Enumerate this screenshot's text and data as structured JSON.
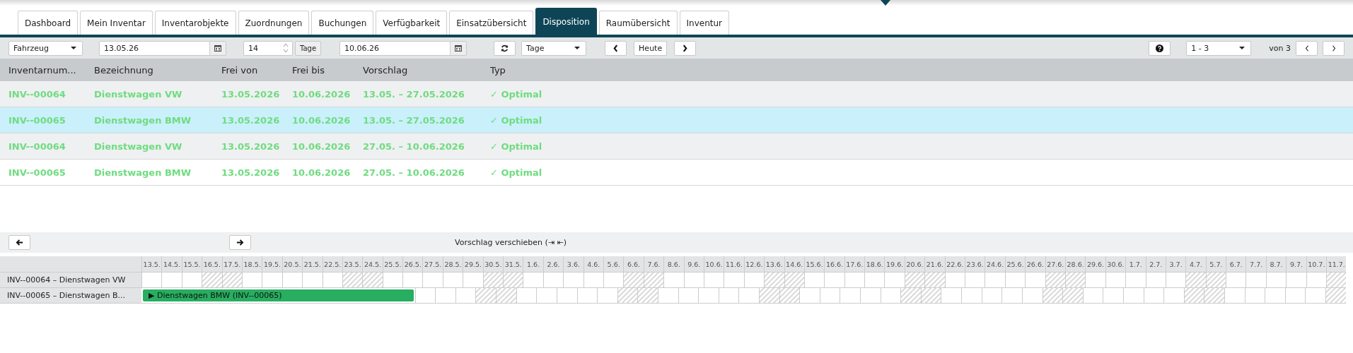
{
  "tabs": [
    {
      "label": "Dashboard",
      "selected": false
    },
    {
      "label": "Mein Inventar",
      "selected": false
    },
    {
      "label": "Inventarobjekte",
      "selected": false
    },
    {
      "label": "Zuordnungen",
      "selected": false
    },
    {
      "label": "Buchungen",
      "selected": false
    },
    {
      "label": "Verfügbarkeit",
      "selected": false
    },
    {
      "label": "Einsatzübersicht",
      "selected": false
    },
    {
      "label": "Disposition",
      "selected": true
    },
    {
      "label": "Raumübersicht",
      "selected": false
    },
    {
      "label": "Inventur",
      "selected": false
    }
  ],
  "toolbar": {
    "category": "Fahrzeug",
    "start_date": "13.05.26",
    "duration": "14",
    "duration_unit": "Tage",
    "end_date": "10.06.26",
    "scale": "Tage",
    "today": "Heute",
    "page_range": "1 - 3",
    "page_total": "von 3"
  },
  "table": {
    "columns": [
      "Inventarnum...",
      "Bezeichnung",
      "Frei von",
      "Frei bis",
      "Vorschlag",
      "Typ"
    ],
    "rows": [
      {
        "selected": false,
        "cells": [
          "INV--00064",
          "Dienstwagen VW",
          "13.05.2026",
          "10.06.2026",
          "13.05. – 27.05.2026",
          "✓ Optimal"
        ]
      },
      {
        "selected": true,
        "cells": [
          "INV--00065",
          "Dienstwagen BMW",
          "13.05.2026",
          "10.06.2026",
          "13.05. – 27.05.2026",
          "✓ Optimal"
        ]
      },
      {
        "selected": false,
        "cells": [
          "INV--00064",
          "Dienstwagen VW",
          "13.05.2026",
          "10.06.2026",
          "27.05. – 10.06.2026",
          "✓ Optimal"
        ]
      },
      {
        "selected": false,
        "cells": [
          "INV--00065",
          "Dienstwagen BMW",
          "13.05.2026",
          "10.06.2026",
          "27.05. – 10.06.2026",
          "✓ Optimal"
        ]
      }
    ]
  },
  "timeline": {
    "shift_label": "Vorschlag verschieben (⇥ ⇤)",
    "days": [
      {
        "label": "13.5.",
        "weekend": false
      },
      {
        "label": "14.5.",
        "weekend": false
      },
      {
        "label": "15.5.",
        "weekend": false
      },
      {
        "label": "16.5.",
        "weekend": true
      },
      {
        "label": "17.5.",
        "weekend": true
      },
      {
        "label": "18.5.",
        "weekend": false
      },
      {
        "label": "19.5.",
        "weekend": false
      },
      {
        "label": "20.5.",
        "weekend": false
      },
      {
        "label": "21.5.",
        "weekend": false
      },
      {
        "label": "22.5.",
        "weekend": false
      },
      {
        "label": "23.5.",
        "weekend": true
      },
      {
        "label": "24.5.",
        "weekend": true
      },
      {
        "label": "25.5.",
        "weekend": false
      },
      {
        "label": "26.5.",
        "weekend": false
      },
      {
        "label": "27.5.",
        "weekend": false
      },
      {
        "label": "28.5.",
        "weekend": false
      },
      {
        "label": "29.5.",
        "weekend": false
      },
      {
        "label": "30.5.",
        "weekend": true
      },
      {
        "label": "31.5.",
        "weekend": true
      },
      {
        "label": "1.6.",
        "weekend": false
      },
      {
        "label": "2.6.",
        "weekend": false
      },
      {
        "label": "3.6.",
        "weekend": false
      },
      {
        "label": "4.6.",
        "weekend": false
      },
      {
        "label": "5.6.",
        "weekend": false
      },
      {
        "label": "6.6.",
        "weekend": true
      },
      {
        "label": "7.6.",
        "weekend": true
      },
      {
        "label": "8.6.",
        "weekend": false
      },
      {
        "label": "9.6.",
        "weekend": false
      },
      {
        "label": "10.6.",
        "weekend": false
      },
      {
        "label": "11.6.",
        "weekend": false
      },
      {
        "label": "12.6.",
        "weekend": false
      },
      {
        "label": "13.6.",
        "weekend": true
      },
      {
        "label": "14.6.",
        "weekend": true
      },
      {
        "label": "15.6.",
        "weekend": false
      },
      {
        "label": "16.6.",
        "weekend": false
      },
      {
        "label": "17.6.",
        "weekend": false
      },
      {
        "label": "18.6.",
        "weekend": false
      },
      {
        "label": "19.6.",
        "weekend": false
      },
      {
        "label": "20.6.",
        "weekend": true
      },
      {
        "label": "21.6.",
        "weekend": true
      },
      {
        "label": "22.6.",
        "weekend": false
      },
      {
        "label": "23.6.",
        "weekend": false
      },
      {
        "label": "24.6.",
        "weekend": false
      },
      {
        "label": "25.6.",
        "weekend": false
      },
      {
        "label": "26.6.",
        "weekend": false
      },
      {
        "label": "27.6.",
        "weekend": true
      },
      {
        "label": "28.6.",
        "weekend": true
      },
      {
        "label": "29.6.",
        "weekend": false
      },
      {
        "label": "30.6.",
        "weekend": false
      },
      {
        "label": "1.7.",
        "weekend": false
      },
      {
        "label": "2.7.",
        "weekend": false
      },
      {
        "label": "3.7.",
        "weekend": false
      },
      {
        "label": "4.7.",
        "weekend": true
      },
      {
        "label": "5.7.",
        "weekend": true
      },
      {
        "label": "6.7.",
        "weekend": false
      },
      {
        "label": "7.7.",
        "weekend": false
      },
      {
        "label": "8.7.",
        "weekend": false
      },
      {
        "label": "9.7.",
        "weekend": false
      },
      {
        "label": "10.7.",
        "weekend": false
      },
      {
        "label": "11.7.",
        "weekend": true
      }
    ],
    "rows": [
      {
        "label": "INV--00064 – Dienstwagen VW"
      },
      {
        "label": "INV--00065 – Dienstwagen B...",
        "cells": [
          {
            "kind": "bar",
            "label": "▶ Dienstwagen BMW (INV--00065)"
          },
          {
            "kind": "bar"
          },
          {
            "kind": "bar"
          },
          {
            "kind": "bar"
          },
          {
            "kind": "bar"
          },
          {
            "kind": "bar"
          },
          {
            "kind": "bar"
          },
          {
            "kind": "bar"
          },
          {
            "kind": "bar"
          },
          {
            "kind": "bar"
          },
          {
            "kind": "bar"
          },
          {
            "kind": "bar"
          },
          {
            "kind": "bar"
          },
          {
            "kind": "bar"
          }
        ]
      }
    ]
  }
}
